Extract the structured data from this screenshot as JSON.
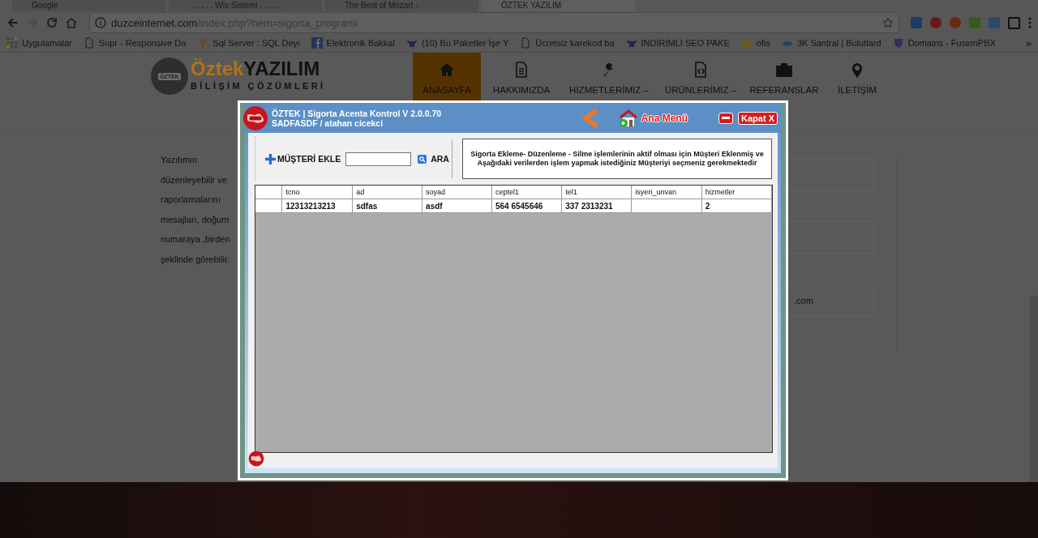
{
  "browser": {
    "tabs": [
      {
        "title": "Google",
        "selected": false
      },
      {
        "title": ". . . . . . Wis Sistemi . . . . . .",
        "selected": false
      },
      {
        "title": "The Best of Mozart -",
        "selected": false
      },
      {
        "title": "ÖZTEK YAZILIM",
        "selected": true
      }
    ],
    "address": {
      "host": "duzceinternet.com",
      "path": "/index.php?hem=sigorta_programi"
    },
    "bookmarks": [
      {
        "label": "Uygulamalar",
        "kind": "apps"
      },
      {
        "label": "Supr - Responsive Da",
        "kind": "page"
      },
      {
        "label": "Sql Server : SQL Deyi",
        "kind": "y"
      },
      {
        "label": "Elektronik Bakkal",
        "kind": "facebook"
      },
      {
        "label": "(10) Bu Paketler İşe Y",
        "kind": "bull"
      },
      {
        "label": "Ücretsiz karekod ba",
        "kind": "page"
      },
      {
        "label": "İNDİRİMLİ SEO PAKE",
        "kind": "bull"
      },
      {
        "label": "ofis",
        "kind": "folder"
      },
      {
        "label": "3K Santral | Bulutlard",
        "kind": "cloud"
      },
      {
        "label": "Domains - FusionPBX",
        "kind": "shield"
      }
    ],
    "bookmarks_overflow": "»"
  },
  "site": {
    "logo": {
      "badge": "ÖZTEK",
      "brand": "Öztek",
      "brand_bold": "YAZILIM",
      "tagline": "BİLİŞİM ÇÖZÜMLERİ"
    },
    "nav": [
      {
        "label": "ANASAYFA",
        "kind": "home",
        "selected": true
      },
      {
        "label": "HAKKIMIZDA",
        "kind": "document",
        "selected": false
      },
      {
        "label": "HİZMETLERİMİZ –",
        "kind": "wrench",
        "selected": false
      },
      {
        "label": "ÜRÜNLERİMİZ –",
        "kind": "code",
        "selected": false
      },
      {
        "label": "REFERANSLAR",
        "kind": "briefcase",
        "selected": false
      },
      {
        "label": "İLETİŞİM",
        "kind": "pin",
        "selected": false
      }
    ],
    "text_lines": [
      "Yazılımın",
      "düzenleyebilir ve",
      "raporlamalarını",
      "mesajları, doğum",
      "numaraya ,birden",
      "şeklinde görebilir."
    ],
    "contact_fragment": ".com"
  },
  "dialog": {
    "title": "ÖZTEK | Sigorta Acenta Kontrol V 2.0.0.70",
    "subtitle": "SADFASDF / atahan cicekci",
    "menu_label": "Ana Menü",
    "close_label": "Kapat X",
    "add_label": "MÜŞTERİ EKLE",
    "search_label": "ARA",
    "info": "Sigorta Ekleme- Düzenleme - Silme işlemlerinin aktif olması için Müşteri Eklenmiş ve Aşağıdaki verilerden işlem yapmak istediğiniz Müşteriyi seçmeniz gerekmektedir",
    "table": {
      "columns": [
        "tcno",
        "ad",
        "soyad",
        "ceptel1",
        "tel1",
        "isyeri_unvan",
        "hizmetler"
      ],
      "rows": [
        [
          "12313213213",
          "sdfas",
          "asdf",
          "564 6545646",
          "337 2313231",
          null,
          "2"
        ]
      ]
    }
  }
}
